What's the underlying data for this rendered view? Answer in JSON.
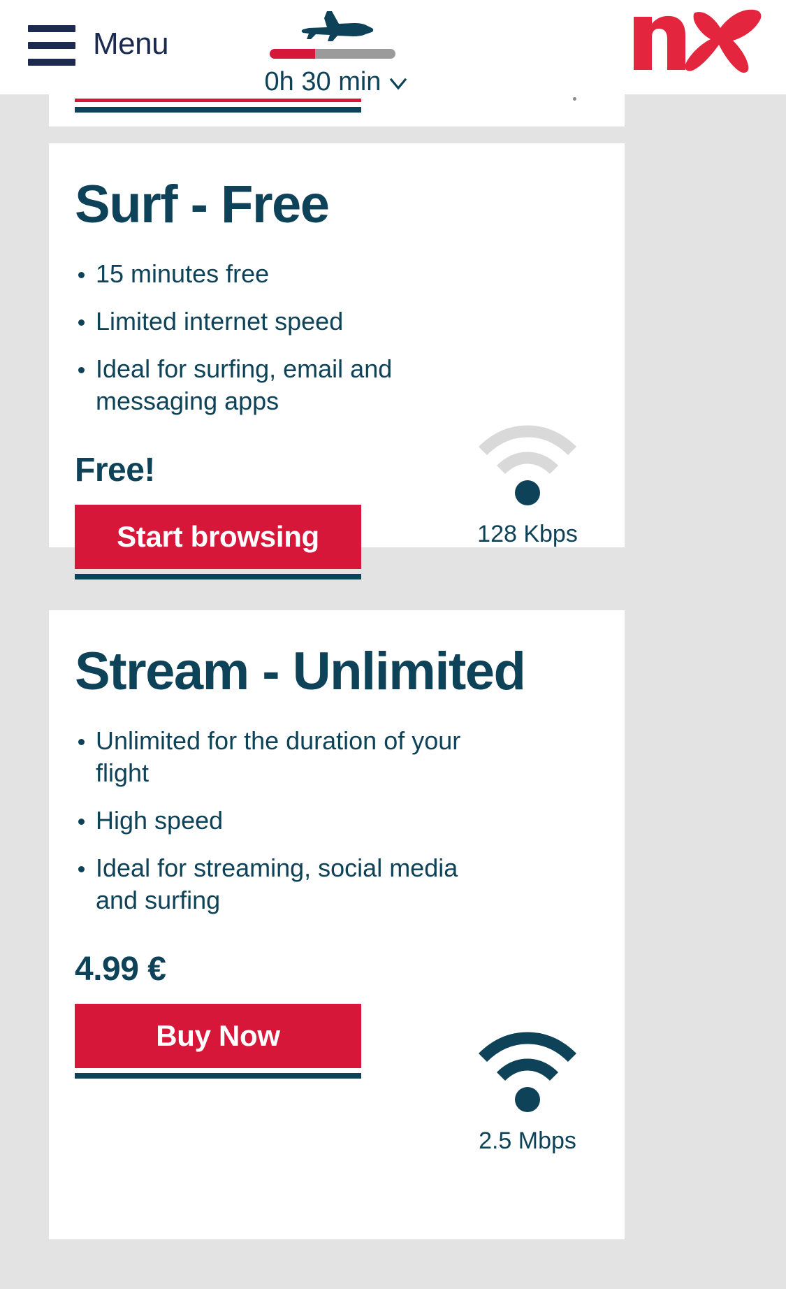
{
  "header": {
    "menu_label": "Menu",
    "menu_icon": "hamburger-icon",
    "flight": {
      "plane_icon": "airplane-icon",
      "remaining_time": "0h 30 min",
      "chevron_icon": "chevron-down-icon",
      "progress_percent": 36,
      "progress_fill_color": "#d6173a",
      "progress_track_color": "#9b9b9b"
    },
    "logo": {
      "name": "norwegian-logo",
      "text": "n",
      "color": "#e3253d"
    }
  },
  "colors": {
    "navy": "#0d4259",
    "red": "#d6173a",
    "page_background": "#e3e3e3",
    "card_background": "#ffffff",
    "wifi_inactive": "#d9d9d9"
  },
  "cards": [
    {
      "id": "surf-free",
      "title": "Surf - Free",
      "features": [
        "15 minutes free",
        "Limited internet speed",
        "Ideal for surfing, email and messaging apps"
      ],
      "price": "Free!",
      "cta_label": "Start browsing",
      "speed_label": "128 Kbps",
      "wifi_icon": "wifi-weak-icon",
      "wifi_active_arcs": 0
    },
    {
      "id": "stream-unlimited",
      "title": "Stream - Unlimited",
      "features": [
        "Unlimited for the duration of your flight",
        "High speed",
        "Ideal for streaming, social media and surfing"
      ],
      "price": "4.99 €",
      "cta_label": "Buy Now",
      "speed_label": "2.5 Mbps",
      "wifi_icon": "wifi-strong-icon",
      "wifi_active_arcs": 2
    }
  ]
}
